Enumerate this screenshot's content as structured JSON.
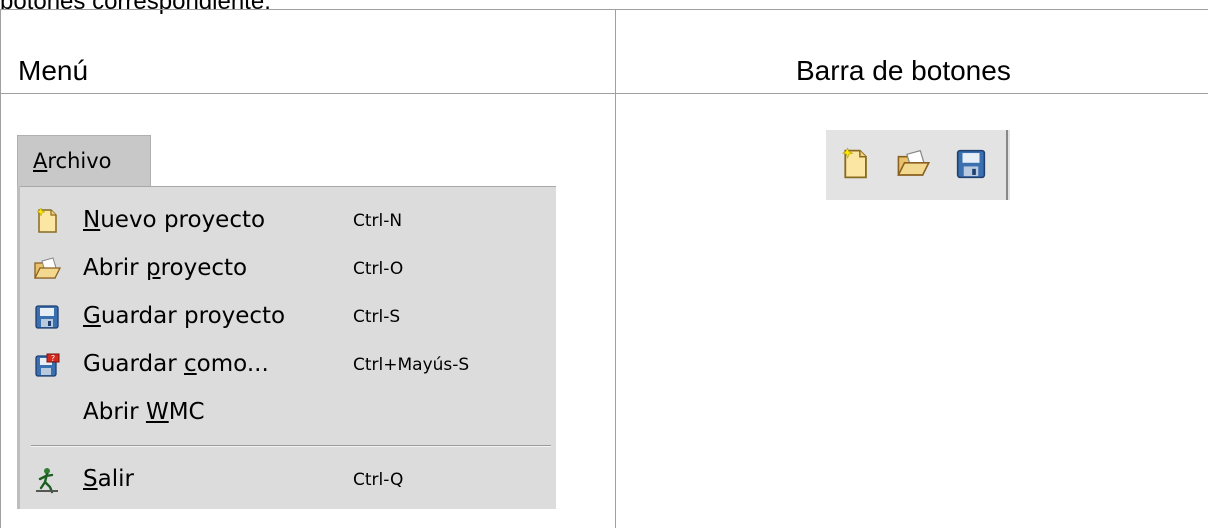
{
  "top_text": "botones correspondiente.",
  "headers": {
    "left": "Menú",
    "right": "Barra de botones"
  },
  "menu": {
    "title_underline": "A",
    "title_rest": "rchivo",
    "items": [
      {
        "icon": "new-document-icon",
        "pre": "",
        "u": "N",
        "post": "uevo proyecto",
        "accel": "Ctrl-N"
      },
      {
        "icon": "open-folder-icon",
        "pre": "Abrir ",
        "u": "p",
        "post": "royecto",
        "accel": "Ctrl-O"
      },
      {
        "icon": "save-disk-icon",
        "pre": "",
        "u": "G",
        "post": "uardar proyecto",
        "accel": "Ctrl-S"
      },
      {
        "icon": "save-as-icon",
        "pre": "Guardar ",
        "u": "c",
        "post": "omo...",
        "accel": "Ctrl+Mayús-S"
      },
      {
        "icon": "",
        "pre": "Abrir ",
        "u": "W",
        "post": "MC",
        "accel": ""
      },
      {
        "icon": "exit-icon",
        "pre": "",
        "u": "S",
        "post": "alir",
        "accel": "Ctrl-Q"
      }
    ]
  },
  "toolbar": {
    "buttons": [
      "new-document-icon",
      "open-folder-icon",
      "save-disk-icon"
    ]
  }
}
